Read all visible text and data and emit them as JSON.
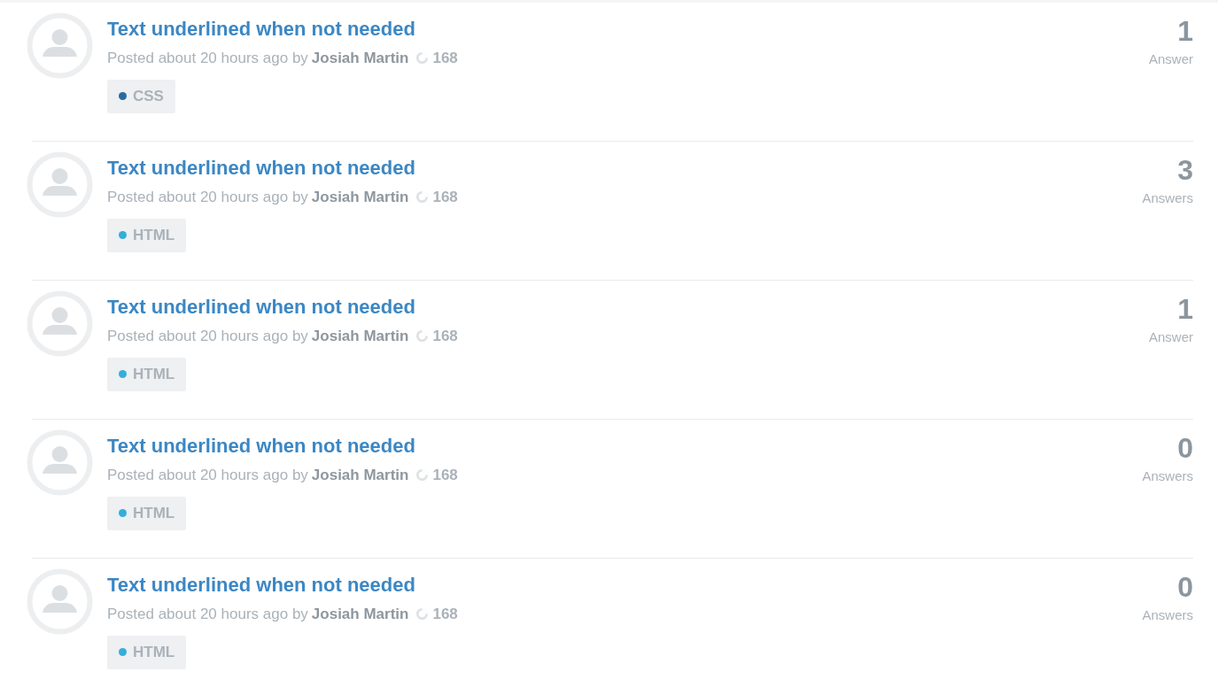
{
  "questions": [
    {
      "title": "Text underlined when not needed",
      "posted": "Posted about 20 hours ago by",
      "author": "Josiah Martin",
      "score": "168",
      "tag": {
        "label": "CSS",
        "color": "#2a6aa3"
      },
      "count": "1",
      "count_label": "Answer"
    },
    {
      "title": "Text underlined when not needed",
      "posted": "Posted about 20 hours ago by",
      "author": "Josiah Martin",
      "score": "168",
      "tag": {
        "label": "HTML",
        "color": "#35aedb"
      },
      "count": "3",
      "count_label": "Answers"
    },
    {
      "title": "Text underlined when not needed",
      "posted": "Posted about 20 hours ago by",
      "author": "Josiah Martin",
      "score": "168",
      "tag": {
        "label": "HTML",
        "color": "#35aedb"
      },
      "count": "1",
      "count_label": "Answer"
    },
    {
      "title": "Text underlined when not needed",
      "posted": "Posted about 20 hours ago by",
      "author": "Josiah Martin",
      "score": "168",
      "tag": {
        "label": "HTML",
        "color": "#35aedb"
      },
      "count": "0",
      "count_label": "Answers"
    },
    {
      "title": "Text underlined when not needed",
      "posted": "Posted about 20 hours ago by",
      "author": "Josiah Martin",
      "score": "168",
      "tag": {
        "label": "HTML",
        "color": "#35aedb"
      },
      "count": "0",
      "count_label": "Answers"
    }
  ]
}
